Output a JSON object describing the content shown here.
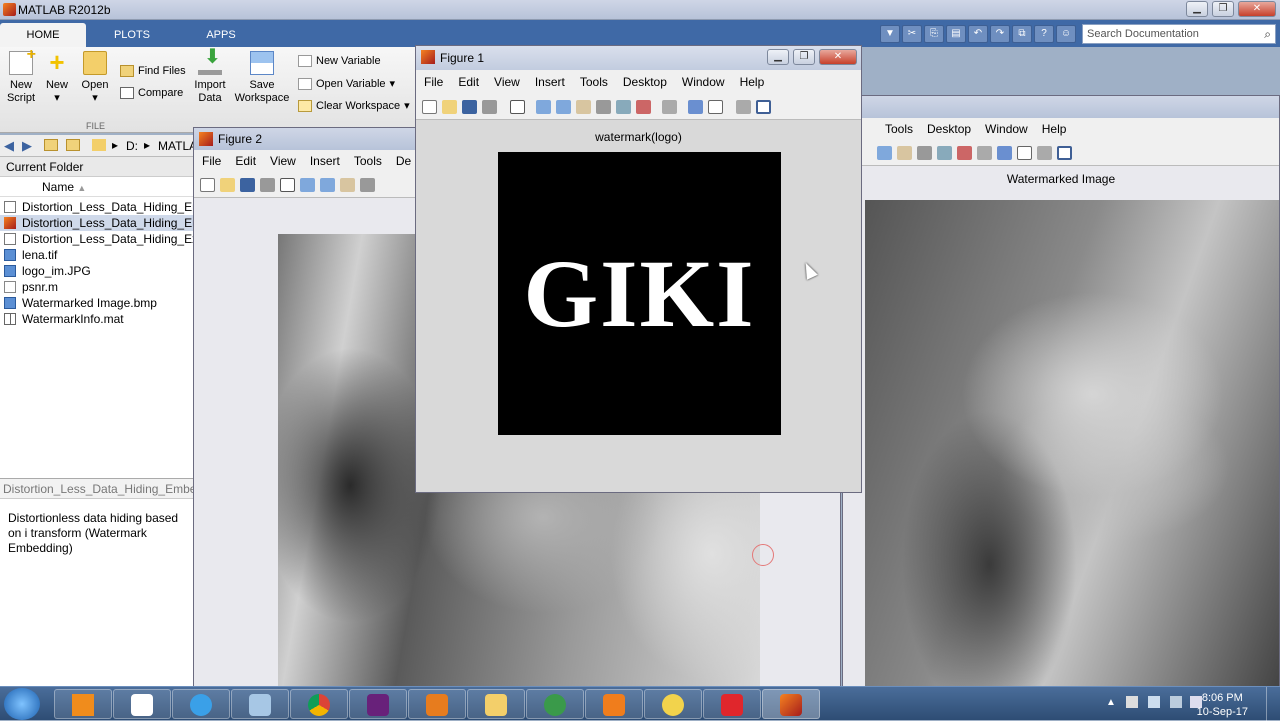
{
  "app": {
    "title": "MATLAB R2012b"
  },
  "tabs": [
    {
      "label": "HOME"
    },
    {
      "label": "PLOTS"
    },
    {
      "label": "APPS"
    }
  ],
  "search": {
    "placeholder": "Search Documentation"
  },
  "ribbon": {
    "new_script": "New\nScript",
    "new": "New",
    "open": "Open",
    "find_files": "Find Files",
    "compare": "Compare",
    "import_data": "Import\nData",
    "save_workspace": "Save\nWorkspace",
    "new_variable": "New Variable",
    "open_variable": "Open Variable",
    "clear_workspace": "Clear Workspace",
    "group_file": "FILE"
  },
  "address": {
    "drive": "D:",
    "folder": "MATLA"
  },
  "current_folder": {
    "title": "Current Folder",
    "column_name": "Name",
    "files": [
      {
        "name": "Distortion_Less_Data_Hiding_Em",
        "icon": "folder-icon",
        "selected": false
      },
      {
        "name": "Distortion_Less_Data_Hiding_Er",
        "icon": "fig-file-icon",
        "selected": true
      },
      {
        "name": "Distortion_Less_Data_Hiding_Ex",
        "icon": "folder-icon",
        "selected": false
      },
      {
        "name": "lena.tif",
        "icon": "image-file-icon",
        "selected": false
      },
      {
        "name": "logo_im.JPG",
        "icon": "image-file-icon",
        "selected": false
      },
      {
        "name": "psnr.m",
        "icon": "m-file-icon",
        "selected": false
      },
      {
        "name": "Watermarked Image.bmp",
        "icon": "image-file-icon",
        "selected": false
      },
      {
        "name": "WatermarkInfo.mat",
        "icon": "mat-file-icon",
        "selected": false
      }
    ]
  },
  "details": {
    "header": "Distortion_Less_Data_Hiding_Embed",
    "description": "Distortionless data hiding based on i transform (Watermark Embedding)"
  },
  "figure1": {
    "title": "Figure 1",
    "menu": [
      "File",
      "Edit",
      "View",
      "Insert",
      "Tools",
      "Desktop",
      "Window",
      "Help"
    ],
    "plot_title": "watermark(logo)",
    "logo_text": "GIKI"
  },
  "figure2": {
    "title": "Figure 2",
    "menu": [
      "File",
      "Edit",
      "View",
      "Insert",
      "Tools",
      "De"
    ]
  },
  "figure3": {
    "menu": [
      "Tools",
      "Desktop",
      "Window",
      "Help"
    ],
    "plot_title": "Watermarked Image"
  },
  "taskbar": {
    "time": "8:06 PM",
    "date": "10-Sep-17"
  }
}
